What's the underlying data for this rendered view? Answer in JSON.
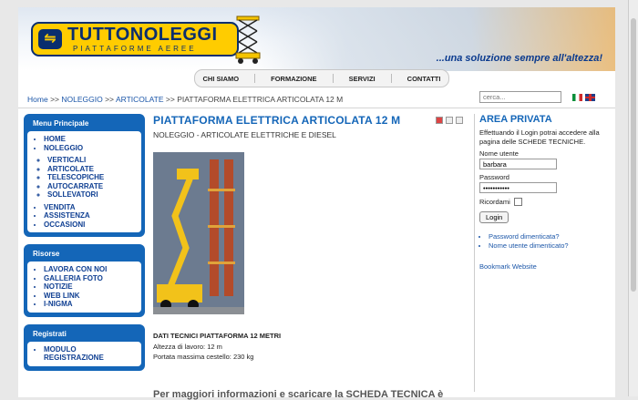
{
  "header": {
    "logo_title": "TUTTONOLEGGI",
    "logo_subtitle": "PIATTAFORME AEREE",
    "slogan": "...una soluzione sempre all'altezza!"
  },
  "nav": {
    "items": [
      {
        "label": "CHI SIAMO"
      },
      {
        "label": "FORMAZIONE"
      },
      {
        "label": "SERVIZI"
      },
      {
        "label": "CONTATTI"
      }
    ]
  },
  "breadcrumb": {
    "home": "Home",
    "sep1": ">>",
    "noleggio": "NOLEGGIO",
    "sep2": ">>",
    "articolate": "ARTICOLATE",
    "sep3": ">>",
    "current": "PIATTAFORMA ELETTRICA ARTICOLATA 12 M"
  },
  "search": {
    "placeholder": "cerca..."
  },
  "sidebar": {
    "menu_title": "Menu Principale",
    "menu": [
      {
        "label": "HOME"
      },
      {
        "label": "NOLEGGIO"
      }
    ],
    "submenu": [
      {
        "label": "VERTICALI"
      },
      {
        "label": "ARTICOLATE"
      },
      {
        "label": "TELESCOPICHE"
      },
      {
        "label": "AUTOCARRATE"
      },
      {
        "label": "SOLLEVATORI"
      }
    ],
    "menu2": [
      {
        "label": "VENDITA"
      },
      {
        "label": "ASSISTENZA"
      },
      {
        "label": "OCCASIONI"
      }
    ],
    "risorse_title": "Risorse",
    "risorse": [
      {
        "label": "LAVORA CON NOI"
      },
      {
        "label": "GALLERIA FOTO"
      },
      {
        "label": "NOTIZIE"
      },
      {
        "label": "WEB LINK"
      },
      {
        "label": "I-NIGMA"
      }
    ],
    "registrati_title": "Registrati",
    "registrati": [
      {
        "label": "MODULO REGISTRAZIONE"
      }
    ]
  },
  "main": {
    "title": "PIATTAFORMA ELETTRICA ARTICOLATA 12 M",
    "category": "NOLEGGIO - ARTICOLATE ELETTRICHE E DIESEL",
    "tech_title": "DATI TECNICI PIATTAFORMA 12 METRI",
    "tech_height": "Altezza di lavoro: 12 m",
    "tech_capacity": "Portata massima cestello: 230 kg",
    "more_info": "Per maggiori informazioni e scaricare la SCHEDA TECNICA è"
  },
  "private_area": {
    "title": "AREA PRIVATA",
    "intro": "Effettuando il Login potrai accedere alla pagina delle SCHEDE TECNICHE.",
    "username_label": "Nome utente",
    "username_value": "barbara",
    "password_label": "Password",
    "password_value": "•••••••••••",
    "remember_label": "Ricordami",
    "login_button": "Login",
    "links": [
      {
        "label": "Password dimenticata?"
      },
      {
        "label": "Nome utente dimenticato?"
      }
    ],
    "bookmark": "Bookmark Website"
  }
}
